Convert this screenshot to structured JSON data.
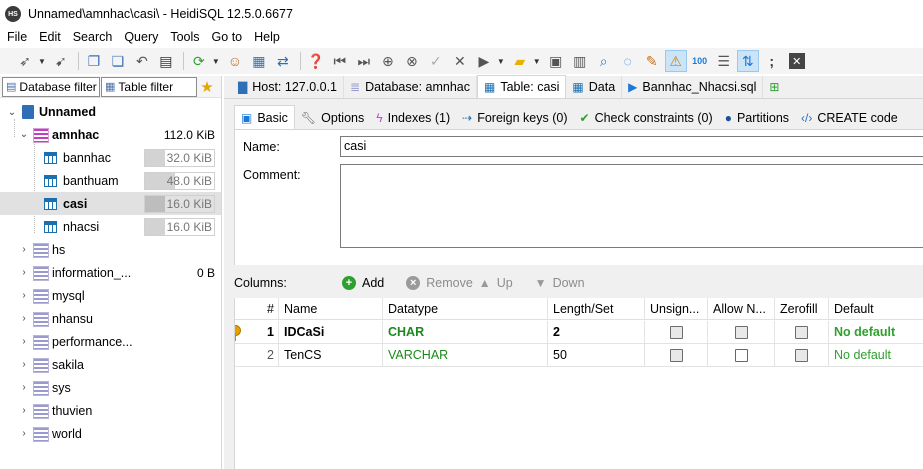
{
  "window": {
    "title": "Unnamed\\amnhac\\casi\\ - HeidiSQL 12.5.0.6677",
    "app_icon": "HS"
  },
  "menu": [
    "File",
    "Edit",
    "Search",
    "Query",
    "Tools",
    "Go to",
    "Help"
  ],
  "toolbar": {
    "icons": [
      "connect-icon",
      "disconnect-icon",
      "copy-icon",
      "paste-icon",
      "undo-icon",
      "print-icon",
      "refresh-icon",
      "users-icon",
      "export-icon",
      "transfer-icon",
      "help-icon",
      "first-icon",
      "last-icon",
      "add-icon",
      "delete-icon",
      "post-icon",
      "cancel-icon",
      "run-icon",
      "explain-icon",
      "open-folder-icon",
      "save-icon",
      "save-as-icon",
      "find-icon",
      "replace-icon",
      "clean-icon",
      "warning-icon",
      "binary-icon",
      "wrap-icon",
      "sync-icon",
      "semicolon-icon",
      "close-icon"
    ]
  },
  "left_panel": {
    "database_filter": "Database filter",
    "table_filter": "Table filter",
    "tree": {
      "root": "Unnamed",
      "active_db": {
        "name": "amnhac",
        "size": "112.0 KiB"
      },
      "tables": [
        {
          "name": "bannhac",
          "size": "32.0 KiB",
          "fill": 0.29
        },
        {
          "name": "banthuam",
          "size": "48.0 KiB",
          "fill": 0.43
        },
        {
          "name": "casi",
          "size": "16.0 KiB",
          "fill": 0.14
        },
        {
          "name": "nhacsi",
          "size": "16.0 KiB",
          "fill": 0.14
        }
      ],
      "other_dbs": [
        {
          "name": "hs",
          "size": ""
        },
        {
          "name": "information_...",
          "size": "0 B"
        },
        {
          "name": "mysql",
          "size": ""
        },
        {
          "name": "nhansu",
          "size": ""
        },
        {
          "name": "performance...",
          "size": ""
        },
        {
          "name": "sakila",
          "size": ""
        },
        {
          "name": "sys",
          "size": ""
        },
        {
          "name": "thuvien",
          "size": ""
        },
        {
          "name": "world",
          "size": ""
        }
      ]
    }
  },
  "query_tabs": [
    {
      "label": "Host: 127.0.0.1",
      "icon": "host-icon"
    },
    {
      "label": "Database: amnhac",
      "icon": "database-icon"
    },
    {
      "label": "Table: casi",
      "icon": "table-icon"
    },
    {
      "label": "Data",
      "icon": "grid-icon"
    },
    {
      "label": "Bannhac_Nhacsi.sql",
      "icon": "query-icon"
    }
  ],
  "editor_tabs": [
    {
      "label": "Basic",
      "icon": "info-icon"
    },
    {
      "label": "Options",
      "icon": "wrench-icon"
    },
    {
      "label": "Indexes (1)",
      "icon": "lightning-icon"
    },
    {
      "label": "Foreign keys (0)",
      "icon": "foreign-key-icon"
    },
    {
      "label": "Check constraints (0)",
      "icon": "check-icon"
    },
    {
      "label": "Partitions",
      "icon": "globe-icon"
    },
    {
      "label": "CREATE code",
      "icon": "code-icon"
    }
  ],
  "basic": {
    "name_label": "Name:",
    "name_value": "casi",
    "comment_label": "Comment:"
  },
  "columns_bar": {
    "label": "Columns:",
    "add": "Add",
    "remove": "Remove",
    "up": "Up",
    "down": "Down"
  },
  "grid": {
    "headers": [
      "#",
      "Name",
      "Datatype",
      "Length/Set",
      "Unsign...",
      "Allow N...",
      "Zerofill",
      "Default"
    ],
    "rows": [
      {
        "num": "1",
        "name": "IDCaSi",
        "datatype": "CHAR",
        "length": "2",
        "default": "No default",
        "primary": true
      },
      {
        "num": "2",
        "name": "TenCS",
        "datatype": "VARCHAR",
        "length": "50",
        "default": "No default",
        "primary": false
      }
    ]
  }
}
